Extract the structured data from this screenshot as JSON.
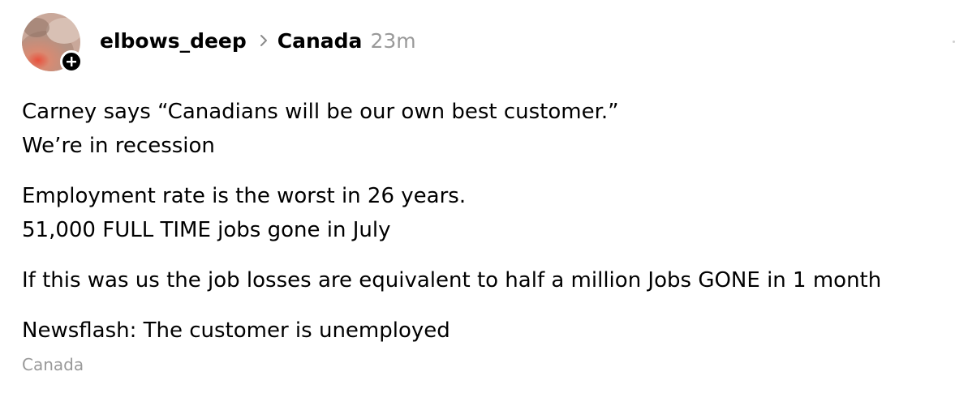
{
  "post": {
    "author": "elbows_deep",
    "community": "Canada",
    "time_ago": "23m",
    "paragraphs": [
      [
        "Carney says “Canadians will be our own best customer.”",
        "We’re in recession"
      ],
      [
        "Employment rate is the worst in 26 years.",
        "51,000 FULL TIME jobs gone in July"
      ],
      [
        "If this was us the job losses are equivalent to half a million Jobs GONE in 1 month"
      ],
      [
        "Newsflash: The customer is unemployed"
      ]
    ],
    "topic_tag": "Canada"
  },
  "icons": {
    "follow": "plus-icon",
    "separator": "chevron-right-icon"
  },
  "colors": {
    "text": "#000000",
    "muted": "#999999",
    "follow_badge": "#000000",
    "avatar_bg": "#c9a89a"
  }
}
